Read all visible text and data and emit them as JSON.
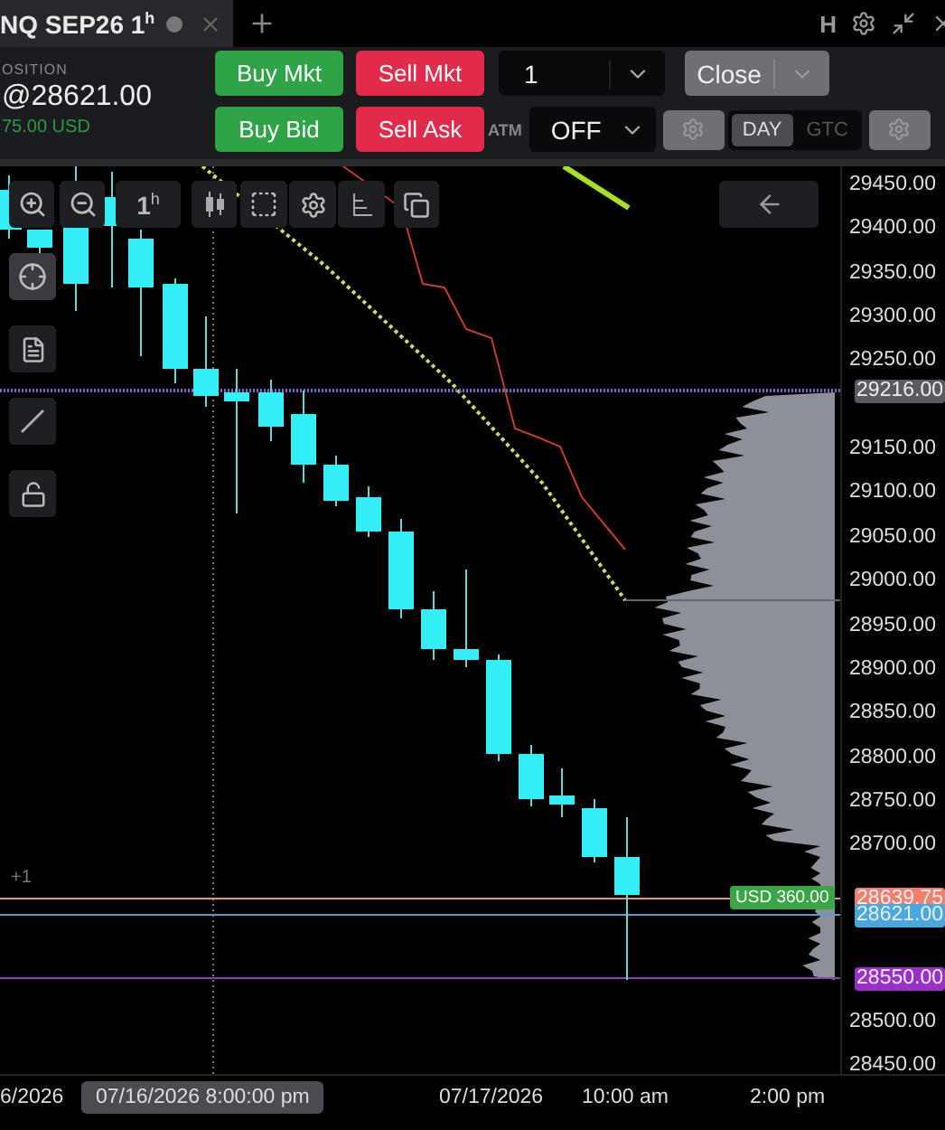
{
  "tab": {
    "title": "NQ SEP26 1$^{h}$",
    "window_letter": "H"
  },
  "position": {
    "label": "OSITION",
    "value": "@28621.00",
    "pnl": "75.00 USD"
  },
  "order_buttons": [
    {
      "label": "Buy Mkt",
      "kind": "buy"
    },
    {
      "label": "Sell Mkt",
      "kind": "sell"
    },
    {
      "label": "Buy Bid",
      "kind": "buy"
    },
    {
      "label": "Sell Ask",
      "kind": "sell"
    }
  ],
  "quantity": {
    "value": "1"
  },
  "close_button": {
    "label": "Close"
  },
  "atm": {
    "label": "ATM",
    "value": "OFF"
  },
  "time_in_force": [
    {
      "label": "DAY",
      "selected": true
    },
    {
      "label": "GTC",
      "selected": false
    }
  ],
  "chart": {
    "interval_button": "1$^{h}$",
    "left_tools": [
      {
        "kind": "crosshair",
        "selected": true
      },
      {
        "kind": "notes",
        "selected": false
      },
      {
        "kind": "line",
        "selected": false
      },
      {
        "kind": "lock",
        "selected": false
      }
    ],
    "price_ticks": [
      "29450.00",
      "29400.00",
      "29350.00",
      "29300.00",
      "29250.00",
      "29150.00",
      "29100.00",
      "29050.00",
      "29000.00",
      "28950.00",
      "28900.00",
      "28850.00",
      "28800.00",
      "28750.00",
      "28700.00",
      "28500.00",
      "28450.00"
    ],
    "price_markers": [
      {
        "label": "29216.00",
        "color": "#5a5b60"
      },
      {
        "label": "28639.75",
        "color": "#f0806e"
      },
      {
        "label": "28621.00",
        "color": "#4aa8e0"
      },
      {
        "label": "28550.00",
        "color": "#9b30c8"
      }
    ],
    "pnl_badge": "USD 360.00",
    "position_marker": "+1",
    "time_labels": [
      {
        "label": "6/2026",
        "highlighted": false
      },
      {
        "label": "07/16/2026 8:00:00 pm",
        "highlighted": true
      },
      {
        "label": "07/17/2026",
        "highlighted": false
      },
      {
        "label": "10:00 am",
        "highlighted": false
      },
      {
        "label": "2:00 pm",
        "highlighted": false
      }
    ]
  }
}
